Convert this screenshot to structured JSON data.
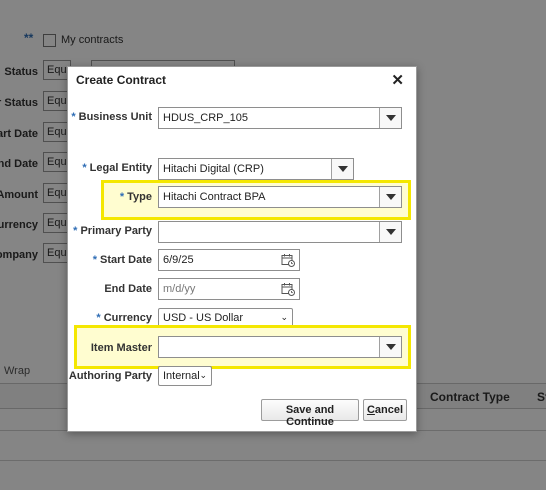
{
  "background": {
    "required_marker": "**",
    "my_contracts_label": "My contracts",
    "filters": [
      {
        "label": "Status",
        "operator": "Equa"
      },
      {
        "label": "er Status",
        "operator": "Equa"
      },
      {
        "label": "tart Date",
        "operator": "Equa"
      },
      {
        "label": "End Date",
        "operator": "Equa"
      },
      {
        "label": "Amount",
        "operator": "Equa"
      },
      {
        "label": "Currency",
        "operator": "Equa"
      },
      {
        "label": "ompany",
        "operator": "Equa"
      }
    ],
    "wrap_label": "Wrap",
    "columns": {
      "contract_type": "Contract Type",
      "status_partial": "St"
    }
  },
  "dialog": {
    "title": "Create Contract",
    "close_glyph": "✕",
    "required_marker": "*",
    "fields": {
      "business_unit": {
        "label": "Business Unit",
        "value": "HDUS_CRP_105"
      },
      "legal_entity": {
        "label": "Legal Entity",
        "value": "Hitachi Digital (CRP)"
      },
      "type": {
        "label": "Type",
        "value": "Hitachi Contract BPA"
      },
      "primary_party": {
        "label": "Primary Party",
        "value": ""
      },
      "start_date": {
        "label": "Start Date",
        "value": "6/9/25"
      },
      "end_date": {
        "label": "End Date",
        "placeholder": "m/d/yy"
      },
      "currency": {
        "label": "Currency",
        "value": "USD - US Dollar"
      },
      "item_master": {
        "label": "Item Master",
        "value": ""
      },
      "authoring_party": {
        "label": "Authoring Party",
        "value": "Internal"
      }
    },
    "buttons": {
      "save_continue": "Save and Continue",
      "cancel_accesskey": "C",
      "cancel_rest": "ancel"
    },
    "highlight_color": "#f4e700"
  },
  "icons": [
    "calendar-icon",
    "chevron-down-icon",
    "close-icon",
    "checkbox-icon"
  ]
}
